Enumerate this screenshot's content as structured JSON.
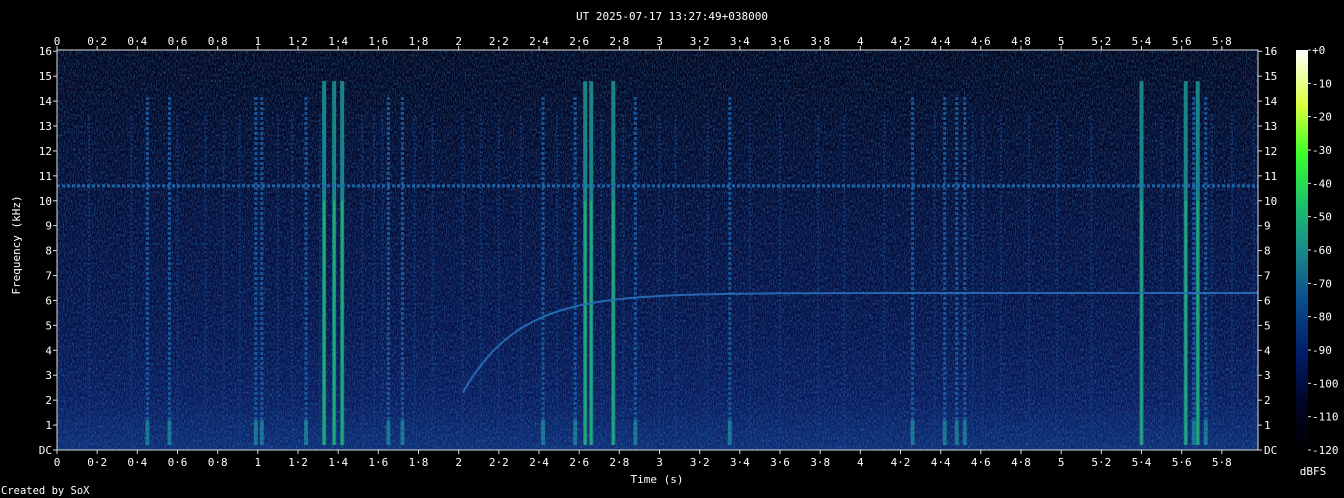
{
  "chart_data": {
    "type": "heatmap",
    "title": "UT 2025-07-17 13:27:49+038000",
    "xlabel": "Time (s)",
    "ylabel": "Frequency (kHz)",
    "xlim": [
      0,
      5.98
    ],
    "ylim": [
      0,
      16.05
    ],
    "x_ticks": [
      "0",
      "0·2",
      "0·4",
      "0·6",
      "0·8",
      "1",
      "1·2",
      "1·4",
      "1·6",
      "1·8",
      "2",
      "2·2",
      "2·4",
      "2·6",
      "2·8",
      "3",
      "3·2",
      "3·4",
      "3·6",
      "3·8",
      "4",
      "4·2",
      "4·4",
      "4·6",
      "4·8",
      "5",
      "5·2",
      "5·4",
      "5·6",
      "5·8"
    ],
    "y_ticks": [
      "DC",
      "1",
      "2",
      "3",
      "4",
      "5",
      "6",
      "7",
      "8",
      "9",
      "10",
      "11",
      "12",
      "13",
      "14",
      "15",
      "16"
    ],
    "colorbar": {
      "label": "dBFS",
      "ticks": [
        "+0",
        "-10",
        "-20",
        "-30",
        "-40",
        "-50",
        "-60",
        "-70",
        "-80",
        "-90",
        "-100",
        "-110",
        "-120"
      ],
      "range_db": [
        -120,
        0
      ]
    },
    "features": {
      "tone_khz": 10.6,
      "sweep": {
        "start_s": 2.02,
        "start_khz": 2.3,
        "end_khz": 6.3
      },
      "strong_bursts_s": [
        1.33,
        1.38,
        1.42,
        2.63,
        2.66,
        2.77,
        5.4,
        5.62,
        5.68
      ],
      "medium_bursts_s": [
        0.45,
        0.56,
        0.99,
        1.02,
        1.24,
        1.65,
        1.72,
        2.42,
        2.58,
        2.88,
        3.35,
        4.26,
        4.42,
        4.48,
        4.52,
        5.66,
        5.72
      ],
      "weak_bursts_s": [
        0.16,
        0.37,
        0.6,
        0.74,
        0.83,
        0.91,
        1.1,
        1.17,
        1.31,
        1.52,
        1.58,
        1.62,
        1.78,
        1.87,
        2.02,
        2.11,
        2.2,
        2.31,
        2.49,
        2.71,
        2.82,
        3.0,
        3.08,
        3.24,
        3.45,
        3.6,
        3.79,
        3.92,
        4.12,
        4.37,
        4.56,
        4.61,
        4.7,
        4.84,
        4.98,
        5.15,
        5.5,
        5.58,
        5.75,
        5.85,
        5.96
      ]
    }
  },
  "footer": {
    "credit": "Created by SoX"
  }
}
